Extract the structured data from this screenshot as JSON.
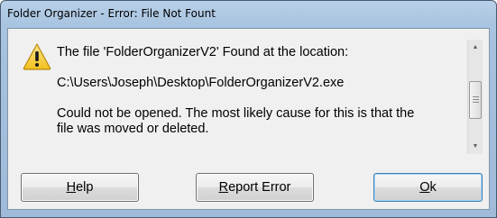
{
  "window": {
    "title": "Folder Organizer - Error: File Not Fount"
  },
  "dialog": {
    "icon": "warning-icon",
    "message_lines": [
      "The file 'FolderOrganizerV2' Found at the location:",
      "C:\\Users\\Joseph\\Desktop\\FolderOrganizerV2.exe",
      "Could not be opened.  The most likely cause for this is that the",
      "file was moved or deleted."
    ]
  },
  "buttons": {
    "help": {
      "accel": "H",
      "rest": "elp"
    },
    "report": {
      "accel": "R",
      "rest": "eport Error"
    },
    "ok": {
      "accel": "O",
      "rest": "k"
    }
  },
  "colors": {
    "warning_fill": "#f7d33b",
    "title_bar": "#b8d0e8",
    "dialog_bg": "#f0f0f0"
  }
}
